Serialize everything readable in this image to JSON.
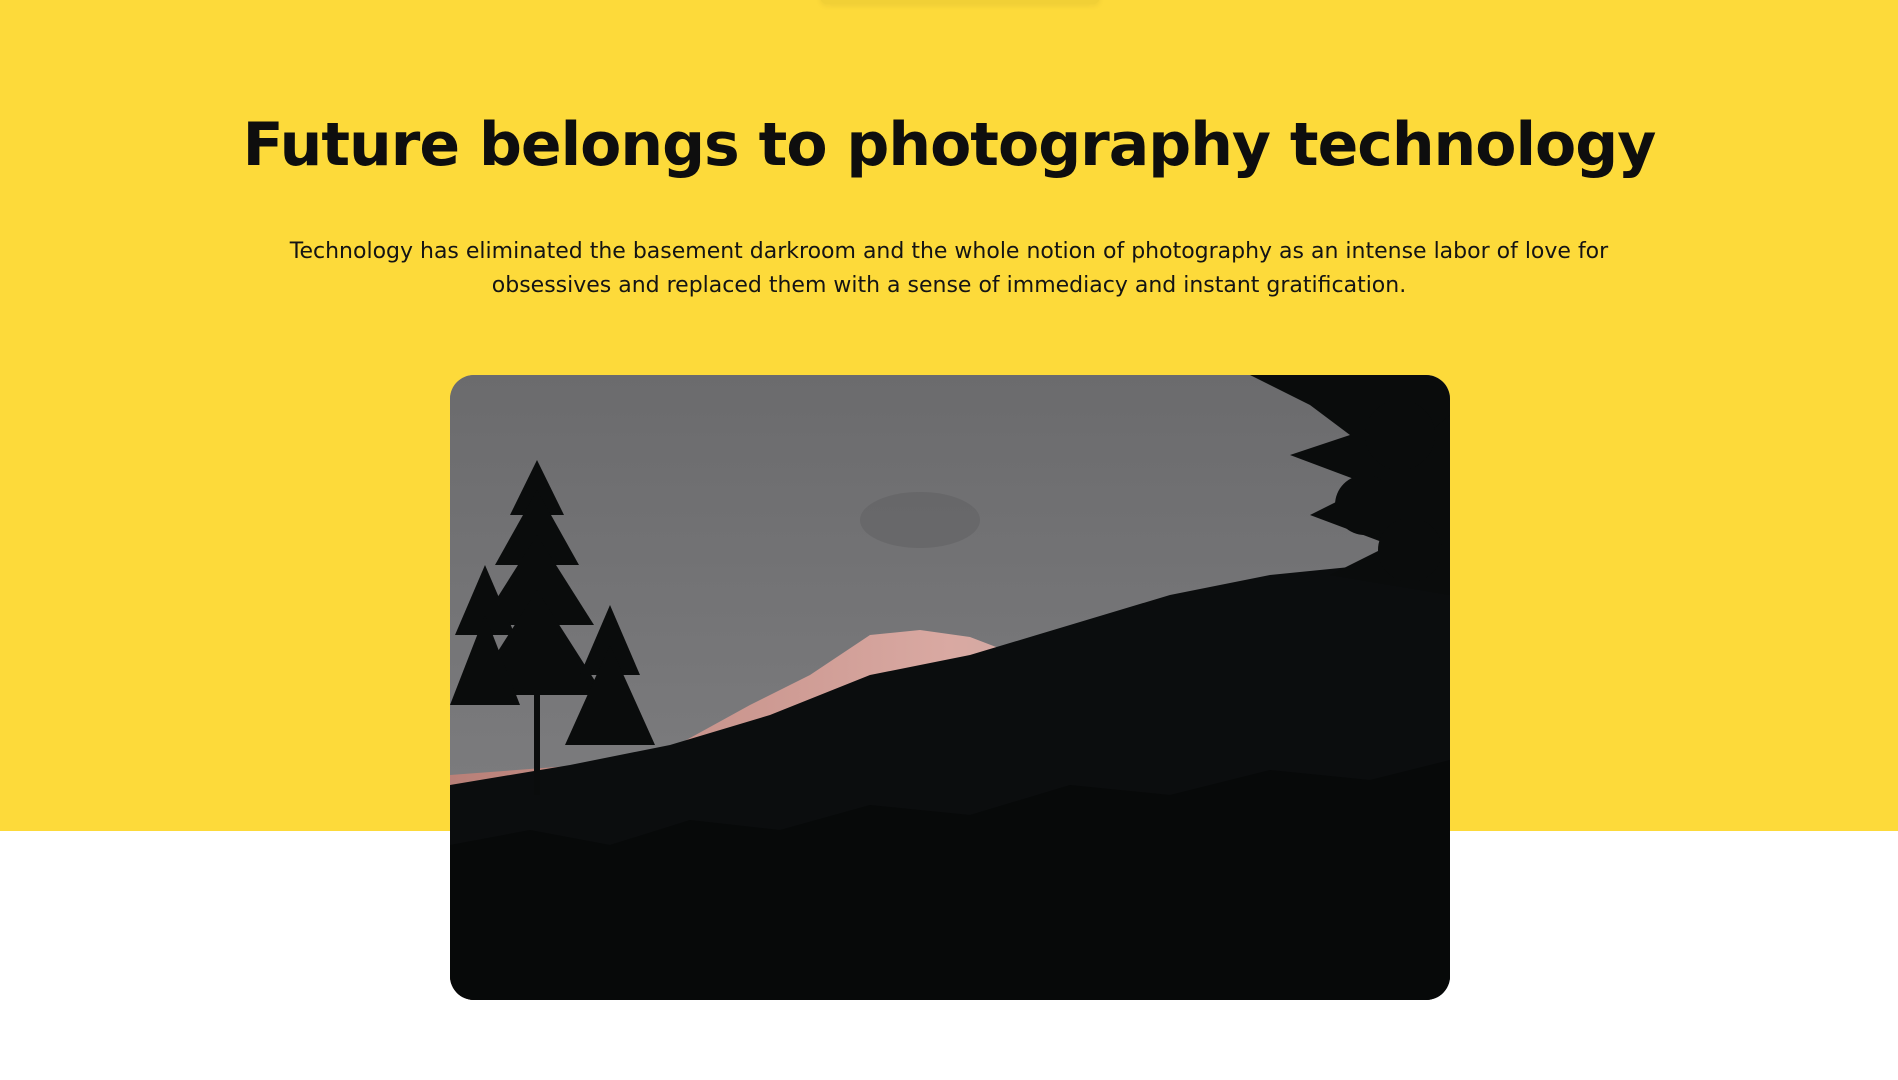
{
  "hero": {
    "title": "Future belongs to photography technology",
    "description": "Technology has eliminated the basement darkroom and the whole notion of photography as an intense labor of love for obsessives and replaced them with a sense of immediacy and instant gratification."
  },
  "colors": {
    "hero_background": "#fdda3a",
    "page_background": "#ffffff",
    "text": "#0e0e0e"
  },
  "image": {
    "subject": "mountain-landscape-photo"
  }
}
